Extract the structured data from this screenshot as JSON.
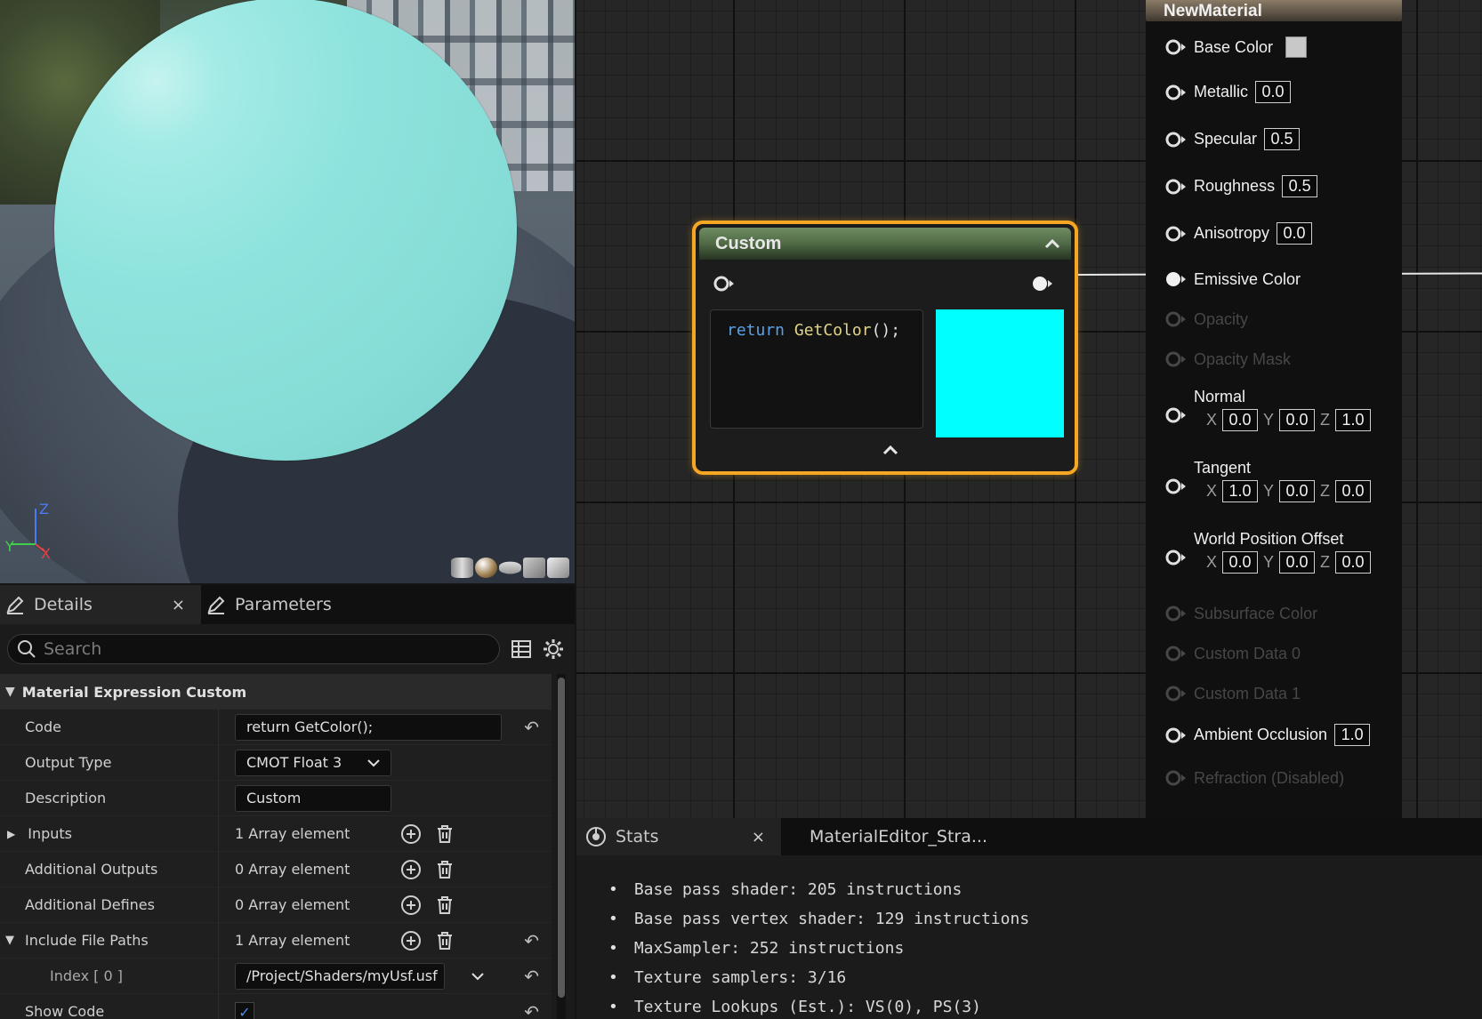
{
  "viewport": {
    "axis": {
      "z": "Z",
      "y": "Y",
      "x": "X"
    },
    "sphere_color": "#8fe3de"
  },
  "details": {
    "tabs": [
      {
        "label": "Details"
      },
      {
        "label": "Parameters"
      }
    ],
    "close": "×",
    "search_placeholder": "Search",
    "section_label": "Material Expression Custom",
    "code_label": "Code",
    "code_value": "return GetColor();",
    "output_type_label": "Output Type",
    "output_type_value": "CMOT Float 3",
    "description_label": "Description",
    "description_value": "Custom",
    "inputs_label": "Inputs",
    "inputs_value": "1 Array element",
    "additional_outputs_label": "Additional Outputs",
    "additional_outputs_value": "0 Array element",
    "additional_defines_label": "Additional Defines",
    "additional_defines_value": "0 Array element",
    "include_paths_label": "Include File Paths",
    "include_paths_value": "1 Array element",
    "index_label": "Index [ 0 ]",
    "index_value": "/Project/Shaders/myUsf.usf",
    "show_code_label": "Show Code"
  },
  "custom_node": {
    "title": "Custom",
    "code_keyword": "return",
    "code_func": "GetColor",
    "code_punct": "();",
    "preview_color": "#00ffff",
    "border_color": "#f5a623"
  },
  "material_node": {
    "title": "NewMaterial",
    "base_color": "Base Color",
    "metallic": "Metallic",
    "metallic_value": "0.0",
    "specular": "Specular",
    "specular_value": "0.5",
    "roughness": "Roughness",
    "roughness_value": "0.5",
    "anisotropy": "Anisotropy",
    "anisotropy_value": "0.0",
    "emissive": "Emissive Color",
    "opacity": "Opacity",
    "opacity_mask": "Opacity Mask",
    "normal": "Normal",
    "normal_xyz": [
      "0.0",
      "0.0",
      "1.0"
    ],
    "tangent": "Tangent",
    "tangent_xyz": [
      "1.0",
      "0.0",
      "0.0"
    ],
    "wpo": "World Position Offset",
    "wpo_xyz": [
      "0.0",
      "0.0",
      "0.0"
    ],
    "subsurface": "Subsurface Color",
    "custom0": "Custom Data 0",
    "custom1": "Custom Data 1",
    "ao": "Ambient Occlusion",
    "ao_value": "1.0",
    "refraction": "Refraction (Disabled)",
    "xyz_labels": [
      "X",
      "Y",
      "Z"
    ]
  },
  "stats": {
    "tab_label": "Stats",
    "tab2_label": "MaterialEditor_Stra...",
    "lines": [
      "Base pass shader: 205 instructions",
      "Base pass vertex shader: 129 instructions",
      "MaxSampler: 252 instructions",
      "Texture samplers: 3/16",
      "Texture Lookups (Est.): VS(0), PS(3)"
    ]
  }
}
